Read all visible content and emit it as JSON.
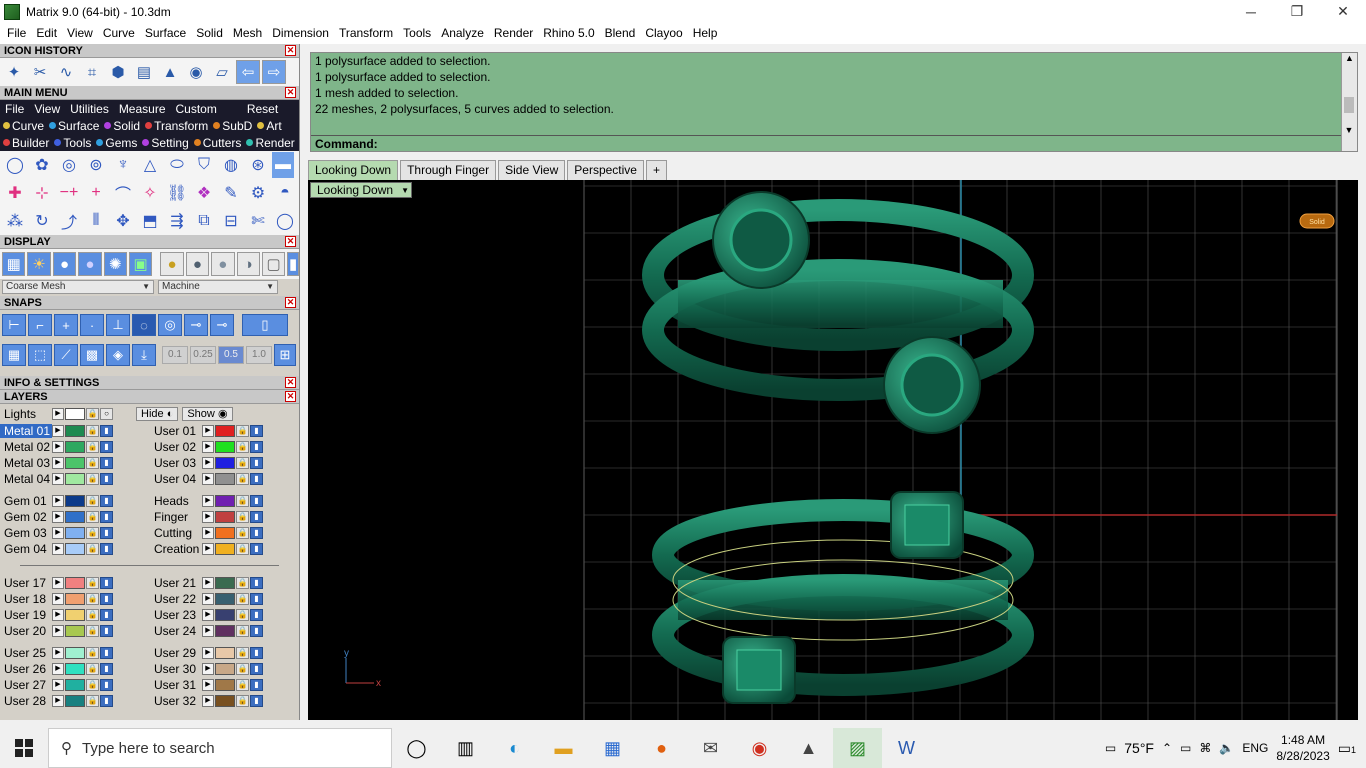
{
  "window": {
    "title": "Matrix 9.0 (64-bit) - 10.3dm",
    "controls": {
      "minimize": "─",
      "maximize": "❐",
      "close": "✕"
    }
  },
  "menubar": [
    "File",
    "Edit",
    "View",
    "Curve",
    "Surface",
    "Solid",
    "Mesh",
    "Dimension",
    "Transform",
    "Tools",
    "Analyze",
    "Render",
    "Rhino 5.0",
    "Blend",
    "Clayoo",
    "Help"
  ],
  "panels": {
    "icon_history": "ICON HISTORY",
    "main_menu": "MAIN MENU",
    "display": "DISPLAY",
    "snaps": "SNAPS",
    "info": "INFO & SETTINGS",
    "layers": "LAYERS"
  },
  "main_menu": {
    "tabs": [
      "File",
      "View",
      "Utilities",
      "Measure",
      "Custom"
    ],
    "reset": "Reset",
    "row1": [
      {
        "label": "Curve",
        "color": "#e0c040"
      },
      {
        "label": "Surface",
        "color": "#30a0e0"
      },
      {
        "label": "Solid",
        "color": "#b040e0"
      },
      {
        "label": "Transform",
        "color": "#e04040"
      },
      {
        "label": "SubD",
        "color": "#e08020"
      },
      {
        "label": "Art",
        "color": "#e0c040"
      }
    ],
    "row2": [
      {
        "label": "Builder",
        "color": "#e04040"
      },
      {
        "label": "Tools",
        "color": "#4060e0"
      },
      {
        "label": "Gems",
        "color": "#30a0e0"
      },
      {
        "label": "Setting",
        "color": "#b040e0"
      },
      {
        "label": "Cutters",
        "color": "#e08020"
      },
      {
        "label": "Render",
        "color": "#30c0b0"
      }
    ]
  },
  "display": {
    "mesh_select": "Coarse Mesh",
    "render_select": "Machine"
  },
  "snaps": {
    "values": [
      "0.1",
      "0.25",
      "0.5",
      "1.0"
    ],
    "active": "0.5"
  },
  "layers": {
    "lights_label": "Lights",
    "hide_label": "Hide",
    "show_label": "Show",
    "left_groups": [
      [
        {
          "name": "Metal 01",
          "color": "#1e8a50",
          "selected": true
        },
        {
          "name": "Metal 02",
          "color": "#2ea860"
        },
        {
          "name": "Metal 03",
          "color": "#4cc46a"
        },
        {
          "name": "Metal 04",
          "color": "#a0e8a0"
        }
      ],
      [
        {
          "name": "Gem 01",
          "color": "#0c3a8a"
        },
        {
          "name": "Gem 02",
          "color": "#3070c8"
        },
        {
          "name": "Gem 03",
          "color": "#80b0f0"
        },
        {
          "name": "Gem 04",
          "color": "#a8ccf8"
        }
      ],
      [
        {
          "name": "User 17",
          "color": "#f08080"
        },
        {
          "name": "User 18",
          "color": "#f0a070"
        },
        {
          "name": "User 19",
          "color": "#f0d070"
        },
        {
          "name": "User 20",
          "color": "#a8c850"
        }
      ],
      [
        {
          "name": "User 25",
          "color": "#a0f0d0"
        },
        {
          "name": "User 26",
          "color": "#30e0c0"
        },
        {
          "name": "User 27",
          "color": "#20b0a0"
        },
        {
          "name": "User 28",
          "color": "#188080"
        }
      ]
    ],
    "right_groups": [
      [
        {
          "name": "User 01",
          "color": "#e02020"
        },
        {
          "name": "User 02",
          "color": "#20e020"
        },
        {
          "name": "User 03",
          "color": "#2020e0"
        },
        {
          "name": "User 04",
          "color": "#909090"
        }
      ],
      [
        {
          "name": "Heads",
          "color": "#7020b0"
        },
        {
          "name": "Finger",
          "color": "#c04040"
        },
        {
          "name": "Cutting",
          "color": "#f07020"
        },
        {
          "name": "Creation",
          "color": "#f0b020"
        }
      ],
      [
        {
          "name": "User 21",
          "color": "#3a6a50"
        },
        {
          "name": "User 22",
          "color": "#386070"
        },
        {
          "name": "User 23",
          "color": "#384070"
        },
        {
          "name": "User 24",
          "color": "#603060"
        }
      ],
      [
        {
          "name": "User 29",
          "color": "#e8c8a8"
        },
        {
          "name": "User 30",
          "color": "#c8a888"
        },
        {
          "name": "User 31",
          "color": "#a07848"
        },
        {
          "name": "User 32",
          "color": "#785020"
        }
      ]
    ]
  },
  "command": {
    "history": [
      "1 polysurface added to selection.",
      "1 polysurface added to selection.",
      "1 mesh added to selection.",
      "22 meshes, 2 polysurfaces, 5 curves added to selection."
    ],
    "prompt": "Command:"
  },
  "viewtabs": [
    "Looking Down",
    "Through Finger",
    "Side View",
    "Perspective"
  ],
  "viewport": {
    "label": "Looking Down",
    "axis_x": "x",
    "axis_y": "y",
    "badge": "Solid"
  },
  "taskbar": {
    "search_placeholder": "Type here to search",
    "weather": "75°F",
    "lang": "ENG",
    "time": "1:48 AM",
    "date": "8/28/2023",
    "notif_count": "1"
  }
}
